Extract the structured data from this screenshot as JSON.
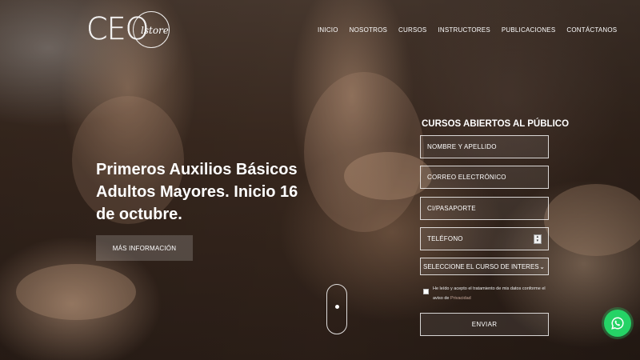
{
  "brand": {
    "logo_main": "CEO",
    "logo_sub": "lstore"
  },
  "nav": {
    "items": [
      "INICIO",
      "NOSOTROS",
      "CURSOS",
      "INSTRUCTORES",
      "PUBLICACIONES",
      "CONTÁCTANOS"
    ]
  },
  "hero": {
    "title": "Primeros Auxilios Básicos Adultos Mayores. Inicio 16 de octubre.",
    "button_label": "MÁS INFORMACIÓN"
  },
  "form": {
    "title": "CURSOS ABIERTOS AL PÚBLICO",
    "name_placeholder": "NOMBRE Y APELLIDO",
    "email_placeholder": "CORREO ELECTRÓNICO",
    "ci_placeholder": "CI/PASAPORTE",
    "phone_placeholder": "TELÉFONO",
    "course_select": "SELECCIONE EL CURSO DE INTERES",
    "consent_text": "He leído y acepto el tratamiento de mis datos conforme el aviso de ",
    "consent_link": "Privacidad",
    "submit_label": "ENVIAR"
  },
  "colors": {
    "whatsapp": "#25d366",
    "link": "#c7a79a"
  },
  "icons": {
    "whatsapp": "whatsapp-icon",
    "scroll": "scroll-mouse-icon"
  }
}
